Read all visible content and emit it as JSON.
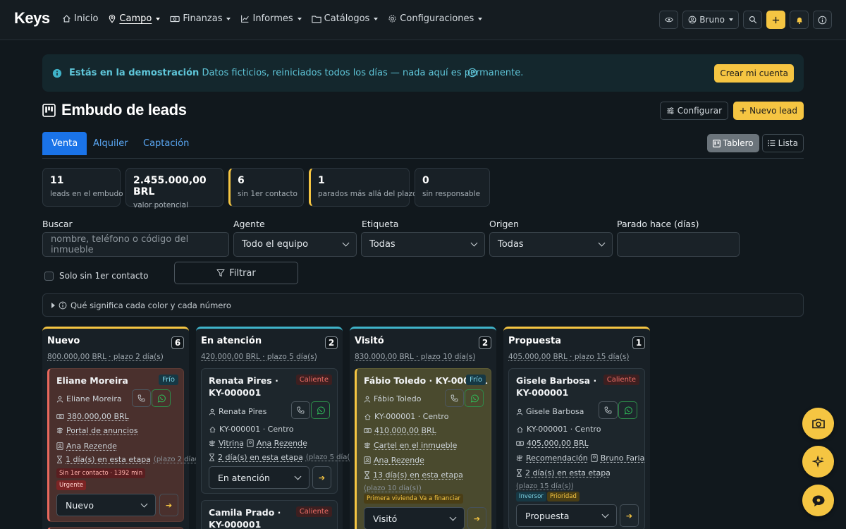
{
  "brand": "Keys",
  "nav": {
    "items": [
      {
        "label": "Inicio",
        "icon": "home-icon"
      },
      {
        "label": "Campo",
        "icon": "map-pin-icon"
      },
      {
        "label": "Finanzas",
        "icon": "cash-icon"
      },
      {
        "label": "Informes",
        "icon": "chart-line-icon"
      },
      {
        "label": "Catálogos",
        "icon": "folder-icon"
      },
      {
        "label": "Configuraciones",
        "icon": "gear-icon"
      }
    ],
    "user": "Bruno"
  },
  "banner": {
    "bold": "Estás en la demostración",
    "text": "Datos ficticios, reiniciados todos los días — nada aquí es permanente.",
    "cta": "Crear mi cuenta"
  },
  "header": {
    "title": "Embudo de leads",
    "configure": "Configurar",
    "new_lead": "Nuevo lead"
  },
  "tabs": [
    "Venta",
    "Alquiler",
    "Captación"
  ],
  "views": [
    "Tablero",
    "Lista"
  ],
  "stats": [
    {
      "value": "11",
      "label": "leads en el embudo"
    },
    {
      "value": "2.455.000,00 BRL",
      "label": "valor potencial"
    },
    {
      "value": "6",
      "label": "sin 1er contacto"
    },
    {
      "value": "1",
      "label": "parados más allá del plazo"
    },
    {
      "value": "0",
      "label": "sin responsable"
    }
  ],
  "filters": {
    "search_label": "Buscar",
    "search_placeholder": "nombre, teléfono o código del inmueble",
    "agent_label": "Agente",
    "agent_value": "Todo el equipo",
    "tag_label": "Etiqueta",
    "tag_value": "Todas",
    "origin_label": "Origen",
    "origin_value": "Todas",
    "stalled_label": "Parado hace (días)",
    "stalled_value": "",
    "only_no_contact": "Solo sin 1er contacto",
    "filter_button": "Filtrar"
  },
  "legend": "Qué significa cada color y cada número",
  "columns": [
    {
      "title": "Nuevo",
      "count": "6",
      "sub": "800.000,00 BRL · plazo 2 día(s)",
      "cards": [
        {
          "name": "Eliane Moreira",
          "badge": "Frío",
          "contact": "Eliane Moreira",
          "value": "380.000,00 BRL",
          "origin": "Portal de anuncios",
          "agent": "Ana Rezende",
          "time": "1 día(s) en esta etapa",
          "deadline": "(plazo 2 día(s))",
          "pill1": "Sin 1er contacto · 1392 min",
          "pill2": "Urgente",
          "stage": "Nuevo"
        }
      ]
    },
    {
      "title": "En atención",
      "count": "2",
      "sub": "420.000,00 BRL · plazo 5 día(s)",
      "cards": [
        {
          "name": "Renata Pires · KY-000001",
          "badge": "Caliente",
          "contact": "Renata Pires",
          "property": "KY-000001 · Centro",
          "origin": "Vitrina",
          "agent": "Ana Rezende",
          "time": "2 día(s) en esta etapa",
          "deadline": "(plazo 5 día(s))",
          "stage": "En atención"
        },
        {
          "name": "Camila Prado · KY-000001",
          "badge": "Caliente"
        }
      ]
    },
    {
      "title": "Visitó",
      "count": "2",
      "sub": "830.000,00 BRL · plazo 10 día(s)",
      "cards": [
        {
          "name": "Fábio Toledo · KY-000001",
          "badge": "Frío",
          "contact": "Fábio Toledo",
          "property": "KY-000001 · Centro",
          "value": "410.000,00 BRL",
          "origin": "Cartel en el inmueble",
          "agent": "Ana Rezende",
          "time": "13 día(s) en esta etapa",
          "deadline": "(plazo 10 día(s))",
          "pill1": "Primera vivienda",
          "pill2": "Va a financiar",
          "stage": "Visitó"
        }
      ]
    },
    {
      "title": "Propuesta",
      "count": "1",
      "sub": "405.000,00 BRL · plazo 15 día(s)",
      "cards": [
        {
          "name": "Gisele Barbosa · KY-000001",
          "badge": "Caliente",
          "contact": "Gisele Barbosa",
          "property": "KY-000001 · Centro",
          "value": "405.000,00 BRL",
          "origin": "Recomendación",
          "agent": "Bruno Faria",
          "time": "2 día(s) en esta etapa",
          "deadline": "(plazo 15 día(s))",
          "pill1": "Inversor",
          "pill2": "Prioridad",
          "stage": "Propuesta"
        }
      ]
    }
  ],
  "colors": {
    "accent": "#f5c542",
    "primary": "#1a73e8",
    "hot": "#e8685d",
    "cold": "#3fb3c9"
  }
}
